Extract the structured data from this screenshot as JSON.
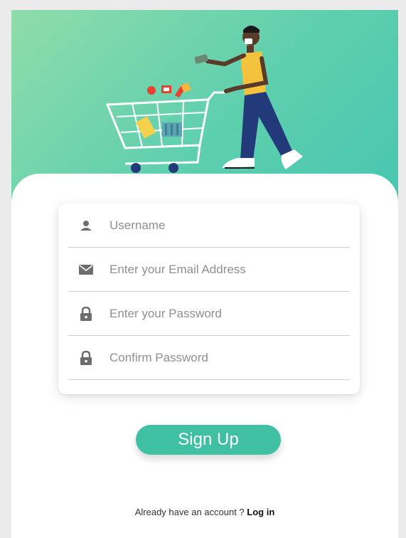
{
  "form": {
    "username_placeholder": "Username",
    "email_placeholder": "Enter your Email Address",
    "password_placeholder": "Enter your Password",
    "confirm_placeholder": "Confirm Password"
  },
  "actions": {
    "signup_label": "Sign Up",
    "login_prompt": "Already have an account ? ",
    "login_link": "Log in"
  },
  "icons": {
    "username": "person-icon",
    "email": "envelope-icon",
    "password": "lock-icon",
    "confirm": "lock-icon"
  },
  "colors": {
    "accent": "#3fc0a3",
    "hero_start": "#8fdcaa",
    "hero_end": "#47c6b0"
  }
}
